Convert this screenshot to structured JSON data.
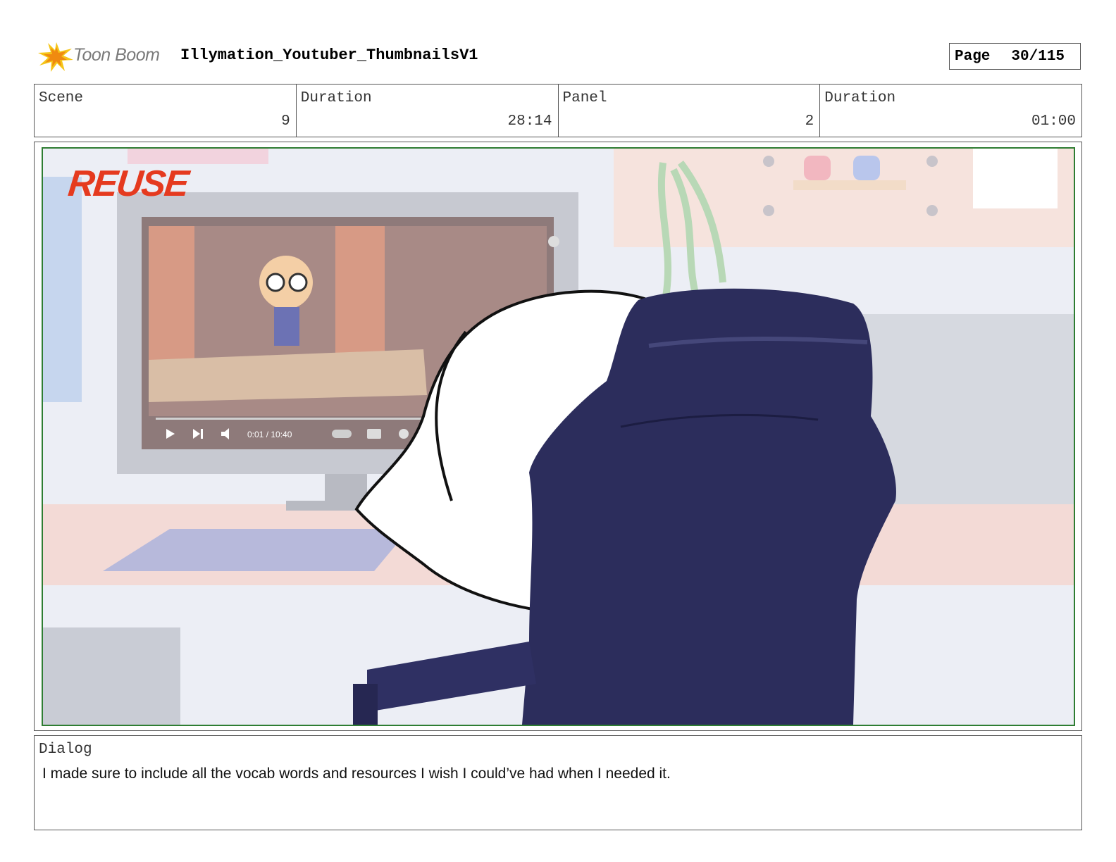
{
  "header": {
    "logo_text": "Toon Boom",
    "project_title": "Illymation_Youtuber_ThumbnailsV1",
    "page_label": "Page",
    "page_value": "30/115"
  },
  "info": {
    "scene_label": "Scene",
    "scene_value": "9",
    "scene_duration_label": "Duration",
    "scene_duration_value": "28:14",
    "panel_label": "Panel",
    "panel_value": "2",
    "panel_duration_label": "Duration",
    "panel_duration_value": "01:00"
  },
  "panel": {
    "stamp_text": "REUSE",
    "video_time": "0:01 / 10:40",
    "cc_label": "CC"
  },
  "dialog": {
    "label": "Dialog",
    "text": "I made sure to include all the vocab words and resources I wish I could’ve had when I needed it."
  }
}
